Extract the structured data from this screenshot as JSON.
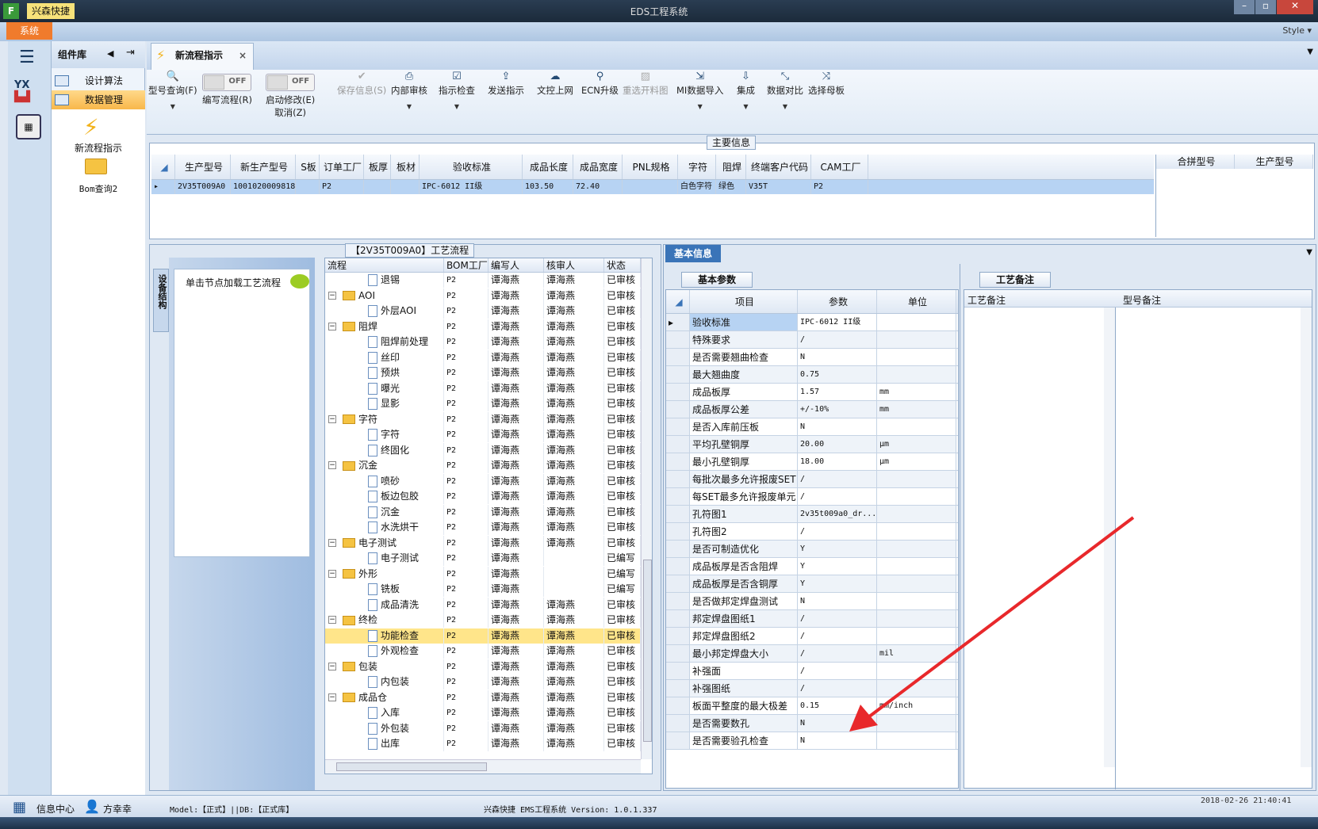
{
  "window": {
    "title": "EDS工程系统",
    "app_badge": "兴森快捷",
    "style_label": "Style"
  },
  "menu": {
    "system_tab": "系统"
  },
  "colors": {
    "accent": "#f07b2c",
    "selection": "#ffe58a",
    "row_selected": "#b7d3f3",
    "arrow": "#e8282b"
  },
  "component_library": {
    "title": "组件库",
    "items": [
      {
        "label": "设计算法",
        "selected": false
      },
      {
        "label": "数据管理",
        "selected": true
      }
    ],
    "shortcuts": [
      {
        "label": "新流程指示",
        "icon": "lightning-icon"
      },
      {
        "label": "Bom查询2",
        "icon": "folder-open-icon"
      }
    ]
  },
  "doc_tab": {
    "label": "新流程指示",
    "close": "×"
  },
  "toolbar": {
    "items": [
      {
        "label": "型号查询(F)",
        "icon": "search-icon",
        "dropdown": true,
        "disabled": false
      },
      {
        "label": "编写流程(R)",
        "toggle": "OFF"
      },
      {
        "label": "启动修改(E)",
        "label2": "取消(Z)",
        "toggle": "OFF"
      },
      {
        "label": "保存信息(S)",
        "icon": "check-icon",
        "disabled": true
      },
      {
        "label": "内部审核",
        "icon": "print-icon",
        "dropdown": true
      },
      {
        "label": "指示检查",
        "icon": "checkbox-icon",
        "dropdown": true
      },
      {
        "label": "发送指示",
        "icon": "upload-icon"
      },
      {
        "label": "文控上网",
        "icon": "cloud-upload-icon"
      },
      {
        "label": "ECN升级",
        "icon": "binoculars-icon"
      },
      {
        "label": "重选开料图",
        "icon": "image-icon",
        "disabled": true
      },
      {
        "label": "MI数据导入",
        "icon": "import-icon",
        "dropdown": true
      },
      {
        "label": "集成",
        "icon": "download-icon",
        "dropdown": true
      },
      {
        "label": "数据对比",
        "icon": "compare-icon",
        "dropdown": true
      },
      {
        "label": "选择母板",
        "icon": "shuffle-icon"
      }
    ]
  },
  "main_info": {
    "group_label": "主要信息",
    "columns": [
      "生产型号",
      "新生产型号",
      "S板",
      "订单工厂",
      "板厚",
      "板材",
      "验收标准",
      "成品长度",
      "成品宽度",
      "PNL规格",
      "字符",
      "阻焊",
      "终端客户代码",
      "CAM工厂"
    ],
    "rows": [
      [
        "2V35T009A0",
        "10010200098181",
        "",
        "P2",
        "",
        "",
        "IPC-6012 II级",
        "103.50",
        "72.40",
        "",
        "白色字符",
        "绿色",
        "V35T",
        "P2"
      ]
    ],
    "side_columns": [
      "合拼型号",
      "生产型号"
    ]
  },
  "device_tab": "设备结构",
  "load_hint": "单击节点加载工艺流程",
  "flow": {
    "group_label": "【2V35T009A0】工艺流程",
    "columns": [
      "流程",
      "BOM工厂",
      "编写人",
      "核审人",
      "状态"
    ],
    "rows": [
      {
        "name": "退锡",
        "folder": false,
        "bom": "P2",
        "writer": "谭海燕",
        "reviewer": "谭海燕",
        "status": "已审核"
      },
      {
        "name": "AOI",
        "folder": true,
        "bom": "P2",
        "writer": "谭海燕",
        "reviewer": "谭海燕",
        "status": "已审核"
      },
      {
        "name": "外层AOI",
        "folder": false,
        "bom": "P2",
        "writer": "谭海燕",
        "reviewer": "谭海燕",
        "status": "已审核"
      },
      {
        "name": "阻焊",
        "folder": true,
        "bom": "P2",
        "writer": "谭海燕",
        "reviewer": "谭海燕",
        "status": "已审核"
      },
      {
        "name": "阻焊前处理",
        "folder": false,
        "bom": "P2",
        "writer": "谭海燕",
        "reviewer": "谭海燕",
        "status": "已审核"
      },
      {
        "name": "丝印",
        "folder": false,
        "bom": "P2",
        "writer": "谭海燕",
        "reviewer": "谭海燕",
        "status": "已审核"
      },
      {
        "name": "预烘",
        "folder": false,
        "bom": "P2",
        "writer": "谭海燕",
        "reviewer": "谭海燕",
        "status": "已审核"
      },
      {
        "name": "曝光",
        "folder": false,
        "bom": "P2",
        "writer": "谭海燕",
        "reviewer": "谭海燕",
        "status": "已审核"
      },
      {
        "name": "显影",
        "folder": false,
        "bom": "P2",
        "writer": "谭海燕",
        "reviewer": "谭海燕",
        "status": "已审核"
      },
      {
        "name": "字符",
        "folder": true,
        "bom": "P2",
        "writer": "谭海燕",
        "reviewer": "谭海燕",
        "status": "已审核"
      },
      {
        "name": "字符",
        "folder": false,
        "bom": "P2",
        "writer": "谭海燕",
        "reviewer": "谭海燕",
        "status": "已审核"
      },
      {
        "name": "终固化",
        "folder": false,
        "bom": "P2",
        "writer": "谭海燕",
        "reviewer": "谭海燕",
        "status": "已审核"
      },
      {
        "name": "沉金",
        "folder": true,
        "bom": "P2",
        "writer": "谭海燕",
        "reviewer": "谭海燕",
        "status": "已审核"
      },
      {
        "name": "喷砂",
        "folder": false,
        "bom": "P2",
        "writer": "谭海燕",
        "reviewer": "谭海燕",
        "status": "已审核"
      },
      {
        "name": "板边包胶",
        "folder": false,
        "bom": "P2",
        "writer": "谭海燕",
        "reviewer": "谭海燕",
        "status": "已审核"
      },
      {
        "name": "沉金",
        "folder": false,
        "bom": "P2",
        "writer": "谭海燕",
        "reviewer": "谭海燕",
        "status": "已审核"
      },
      {
        "name": "水洗烘干",
        "folder": false,
        "bom": "P2",
        "writer": "谭海燕",
        "reviewer": "谭海燕",
        "status": "已审核"
      },
      {
        "name": "电子测试",
        "folder": true,
        "bom": "P2",
        "writer": "谭海燕",
        "reviewer": "谭海燕",
        "status": "已审核"
      },
      {
        "name": "电子测试",
        "folder": false,
        "bom": "P2",
        "writer": "谭海燕",
        "reviewer": "",
        "status": "已编写"
      },
      {
        "name": "外形",
        "folder": true,
        "bom": "P2",
        "writer": "谭海燕",
        "reviewer": "",
        "status": "已编写"
      },
      {
        "name": "铣板",
        "folder": false,
        "bom": "P2",
        "writer": "谭海燕",
        "reviewer": "",
        "status": "已编写"
      },
      {
        "name": "成品清洗",
        "folder": false,
        "bom": "P2",
        "writer": "谭海燕",
        "reviewer": "谭海燕",
        "status": "已审核"
      },
      {
        "name": "终检",
        "folder": true,
        "bom": "P2",
        "writer": "谭海燕",
        "reviewer": "谭海燕",
        "status": "已审核"
      },
      {
        "name": "功能检查",
        "folder": false,
        "bom": "P2",
        "writer": "谭海燕",
        "reviewer": "谭海燕",
        "status": "已审核",
        "selected": true
      },
      {
        "name": "外观检查",
        "folder": false,
        "bom": "P2",
        "writer": "谭海燕",
        "reviewer": "谭海燕",
        "status": "已审核"
      },
      {
        "name": "包装",
        "folder": true,
        "bom": "P2",
        "writer": "谭海燕",
        "reviewer": "谭海燕",
        "status": "已审核"
      },
      {
        "name": "内包装",
        "folder": false,
        "bom": "P2",
        "writer": "谭海燕",
        "reviewer": "谭海燕",
        "status": "已审核"
      },
      {
        "name": "成品仓",
        "folder": true,
        "bom": "P2",
        "writer": "谭海燕",
        "reviewer": "谭海燕",
        "status": "已审核"
      },
      {
        "name": "入库",
        "folder": false,
        "bom": "P2",
        "writer": "谭海燕",
        "reviewer": "谭海燕",
        "status": "已审核"
      },
      {
        "name": "外包装",
        "folder": false,
        "bom": "P2",
        "writer": "谭海燕",
        "reviewer": "谭海燕",
        "status": "已审核"
      },
      {
        "name": "出库",
        "folder": false,
        "bom": "P2",
        "writer": "谭海燕",
        "reviewer": "谭海燕",
        "status": "已审核"
      }
    ]
  },
  "basic_info": {
    "tab": "基本信息",
    "sub_tab": "基本参数",
    "columns": [
      "项目",
      "参数",
      "单位"
    ],
    "rows": [
      [
        "验收标准",
        "IPC-6012 II级",
        ""
      ],
      [
        "特殊要求",
        "/",
        ""
      ],
      [
        "是否需要翘曲检查",
        "N",
        ""
      ],
      [
        "最大翘曲度",
        "0.75",
        ""
      ],
      [
        "成品板厚",
        "1.57",
        "mm"
      ],
      [
        "成品板厚公差",
        "+/-10%",
        "mm"
      ],
      [
        "是否入库前压板",
        "N",
        ""
      ],
      [
        "平均孔壁铜厚",
        "20.00",
        "μm"
      ],
      [
        "最小孔壁铜厚",
        "18.00",
        "μm"
      ],
      [
        "每批次最多允许报废SET",
        "/",
        ""
      ],
      [
        "每SET最多允许报废单元",
        "/",
        ""
      ],
      [
        "孔符图1",
        "2v35t009a0_dr...",
        ""
      ],
      [
        "孔符图2",
        "/",
        ""
      ],
      [
        "是否可制造优化",
        "Y",
        ""
      ],
      [
        "成品板厚是否含阻焊",
        "Y",
        ""
      ],
      [
        "成品板厚是否含铜厚",
        "Y",
        ""
      ],
      [
        "是否做邦定焊盘测试",
        "N",
        ""
      ],
      [
        "邦定焊盘图纸1",
        "/",
        ""
      ],
      [
        "邦定焊盘图纸2",
        "/",
        ""
      ],
      [
        "最小邦定焊盘大小",
        "/",
        "mil"
      ],
      [
        "补强面",
        "/",
        ""
      ],
      [
        "补强图纸",
        "/",
        ""
      ],
      [
        "板面平整度的最大极差",
        "0.15",
        "mm/inch"
      ],
      [
        "是否需要数孔",
        "N",
        ""
      ],
      [
        "是否需要验孔检查",
        "N",
        ""
      ]
    ]
  },
  "process_notes": {
    "tab": "工艺备注",
    "col1": "工艺备注",
    "col2": "型号备注"
  },
  "statusbar": {
    "info_center": "信息中心",
    "user": "方幸幸",
    "model_db": "Model:【正式】||DB:【正式库】",
    "version": "兴森快捷 EMS工程系统 Version: 1.0.1.337",
    "datetime": "2018-02-26 21:40:41"
  }
}
